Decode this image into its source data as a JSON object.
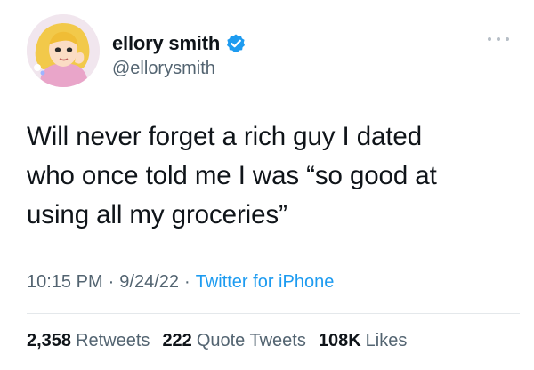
{
  "tweet": {
    "author": {
      "display_name": "ellory smith",
      "handle": "@ellorysmith",
      "verified": true,
      "avatar": "cartoon-girl-avatar"
    },
    "text": "Will never forget a rich guy I dated\nwho once told me I was “so good at\nusing all my groceries”",
    "time": "10:15 PM",
    "separator": "·",
    "date": "9/24/22",
    "source": "Twitter for iPhone",
    "stats": [
      {
        "count": "2,358",
        "label": "Retweets"
      },
      {
        "count": "222",
        "label": "Quote Tweets"
      },
      {
        "count": "108K",
        "label": "Likes"
      }
    ]
  },
  "colors": {
    "text": "#0f1419",
    "secondary": "#536471",
    "accent": "#1d9bf0",
    "divider": "#e4e8eb"
  }
}
